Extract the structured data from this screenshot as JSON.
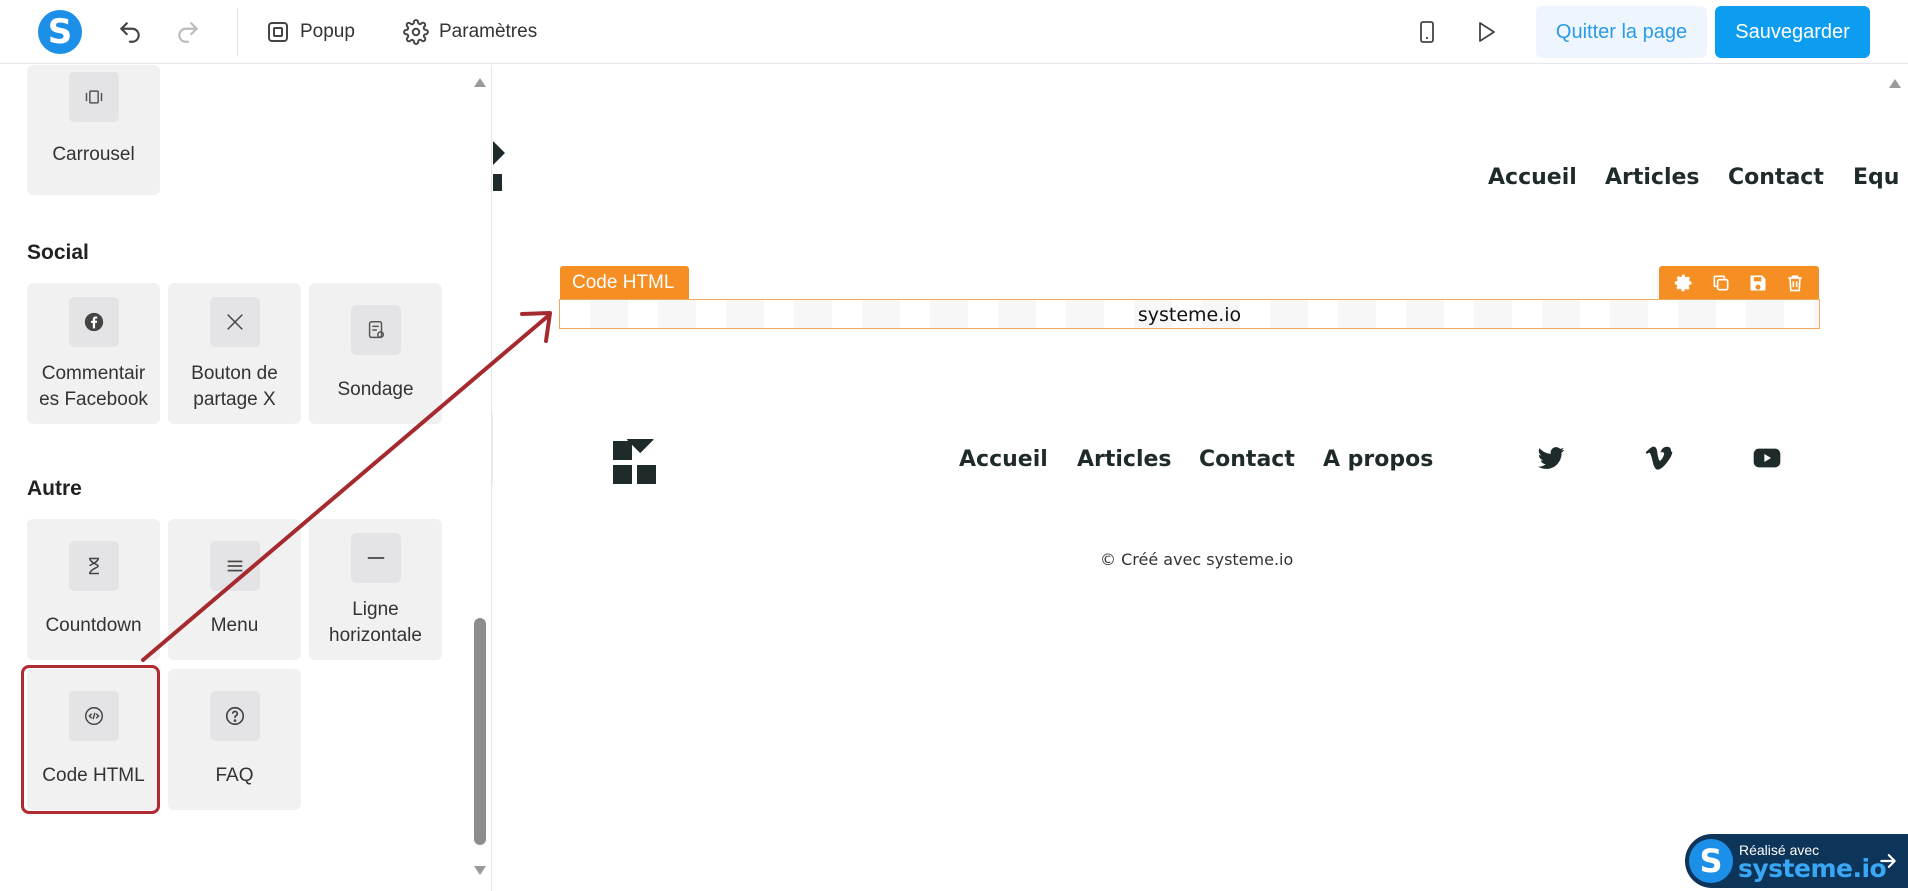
{
  "toolbar": {
    "logo_letter": "S",
    "popup_label": "Popup",
    "settings_label": "Paramètres",
    "quit_label": "Quitter la page",
    "save_label": "Sauvegarder"
  },
  "sidebar": {
    "carousel_tile": {
      "label": "Carrousel",
      "icon": "carousel-icon"
    },
    "social": {
      "title": "Social",
      "items": [
        {
          "label": "Commentair es Facebook",
          "line1": "Commentair",
          "line2": "es Facebook",
          "icon": "facebook-icon"
        },
        {
          "label": "Bouton de partage X",
          "line1": "Bouton de",
          "line2": "partage X",
          "icon": "x-icon"
        },
        {
          "label": "Sondage",
          "icon": "survey-icon"
        }
      ]
    },
    "other": {
      "title": "Autre",
      "items": [
        {
          "label": "Countdown",
          "icon": "hourglass-icon"
        },
        {
          "label": "Menu",
          "icon": "menu-icon"
        },
        {
          "label": "Ligne horizontale",
          "line1": "Ligne",
          "line2": "horizontale",
          "icon": "horizontal-line-icon"
        },
        {
          "label": "Code HTML",
          "icon": "code-icon",
          "highlighted": true
        },
        {
          "label": "FAQ",
          "icon": "question-icon"
        }
      ]
    },
    "highlight_color": "#b02a30"
  },
  "canvas": {
    "top_nav": [
      "Accueil",
      "Articles",
      "Contact",
      "Equ"
    ],
    "html_block": {
      "tag_label": "Code HTML",
      "content": "systeme.io",
      "accent_color": "#f58f24"
    },
    "footer_nav": [
      "Accueil",
      "Articles",
      "Contact",
      "A propos"
    ],
    "social_icons": [
      "twitter-icon",
      "vimeo-icon",
      "youtube-icon"
    ],
    "copyright_prefix": "© Créé avec",
    "copyright_link": "systeme.io"
  },
  "badge": {
    "line1": "Réalisé avec",
    "line2": "systeme.io"
  },
  "colors": {
    "primary": "#0d9df0",
    "quit_bg": "#eef5fc",
    "quit_text": "#2a9be8",
    "dark_text": "#1f2b2a",
    "badge_bg": "#0d3459"
  }
}
